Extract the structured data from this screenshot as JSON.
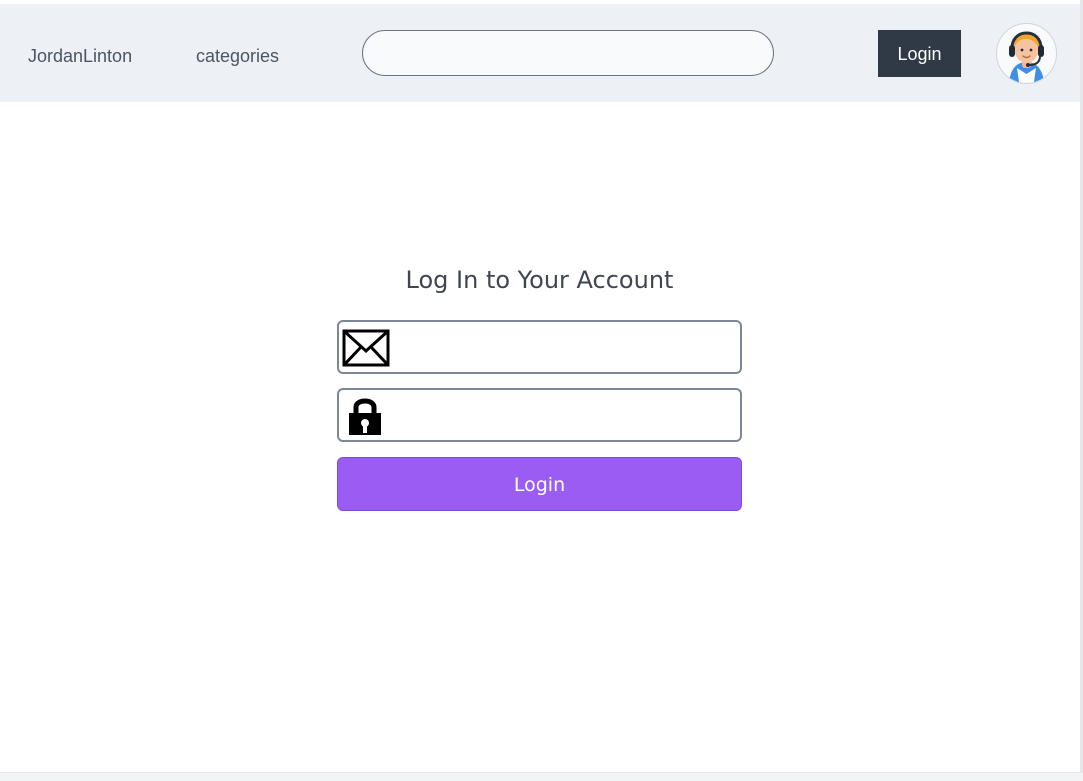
{
  "navbar": {
    "brand": "JordanLinton",
    "categories": "categories",
    "search_value": "",
    "login_label": "Login",
    "avatar_icon": "support-agent-avatar-icon"
  },
  "login_form": {
    "title": "Log In to Your Account",
    "email_value": "",
    "password_value": "",
    "email_icon": "envelope-icon",
    "password_icon": "lock-icon",
    "submit_label": "Login"
  },
  "colors": {
    "navbar_background": "#edf0f4",
    "navbar_login_background": "#2f3a46",
    "submit_background": "#9b5cf3",
    "field_border": "#7d8797"
  }
}
